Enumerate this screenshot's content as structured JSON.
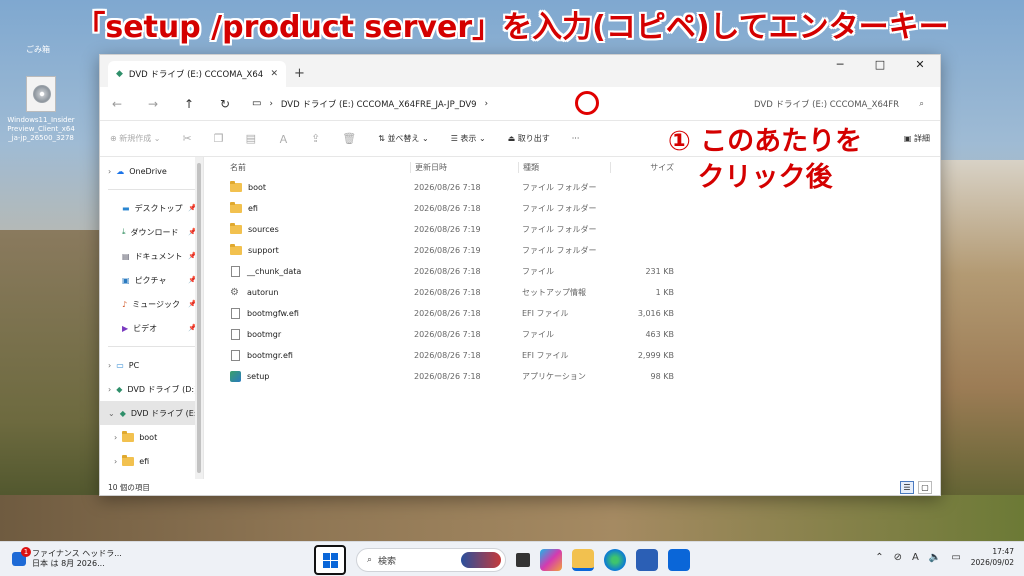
{
  "headline": "「setup /product server」を入力(コピペ)してエンターキー",
  "annotation": {
    "line1": "① このあたりを",
    "line2": "クリック後"
  },
  "desktop": {
    "top_label": "ごみ箱",
    "icon_label": "Windows11_Insider Preview_Client_x64 _ja-jp_26500_3278"
  },
  "window": {
    "tab_title": "DVD ドライブ (E:) CCCOMA_X64",
    "new_tab": "+",
    "minimize": "─",
    "maximize": "□",
    "close": "✕",
    "address": {
      "path_device": "DVD ドライブ (E:) CCCOMA_X64FRE_JA-JP_DV9",
      "search_placeholder": "DVD ドライブ (E:) CCCOMA_X64FR"
    },
    "toolbar": {
      "new": "新規作成",
      "sort": "並べ替え",
      "view": "表示",
      "eject": "取り出す",
      "details": "詳細"
    },
    "nav": {
      "onedrive": "OneDrive",
      "desktop": "デスクトップ",
      "downloads": "ダウンロード",
      "documents": "ドキュメント",
      "pictures": "ピクチャ",
      "music": "ミュージック",
      "videos": "ビデオ",
      "pc": "PC",
      "dvd_d": "DVD ドライブ (D:)",
      "dvd_e": "DVD ドライブ (E:)",
      "boot": "boot",
      "efi": "efi"
    },
    "columns": {
      "name": "名前",
      "date": "更新日時",
      "type": "種類",
      "size": "サイズ"
    },
    "files": [
      {
        "name": "boot",
        "date": "2026/08/26 7:18",
        "type": "ファイル フォルダー",
        "size": ""
      },
      {
        "name": "efi",
        "date": "2026/08/26 7:18",
        "type": "ファイル フォルダー",
        "size": ""
      },
      {
        "name": "sources",
        "date": "2026/08/26 7:19",
        "type": "ファイル フォルダー",
        "size": ""
      },
      {
        "name": "support",
        "date": "2026/08/26 7:19",
        "type": "ファイル フォルダー",
        "size": ""
      },
      {
        "name": "__chunk_data",
        "date": "2026/08/26 7:18",
        "type": "ファイル",
        "size": "231 KB"
      },
      {
        "name": "autorun",
        "date": "2026/08/26 7:18",
        "type": "セットアップ情報",
        "size": "1 KB"
      },
      {
        "name": "bootmgfw.efi",
        "date": "2026/08/26 7:18",
        "type": "EFI ファイル",
        "size": "3,016 KB"
      },
      {
        "name": "bootmgr",
        "date": "2026/08/26 7:18",
        "type": "ファイル",
        "size": "463 KB"
      },
      {
        "name": "bootmgr.efi",
        "date": "2026/08/26 7:18",
        "type": "EFI ファイル",
        "size": "2,999 KB"
      },
      {
        "name": "setup",
        "date": "2026/08/26 7:18",
        "type": "アプリケーション",
        "size": "98 KB"
      }
    ],
    "status": "10 個の項目"
  },
  "taskbar": {
    "news_title": "ファイナンス ヘッドラ...",
    "news_sub": "日本 は 8月 2026...",
    "search_label": "検索",
    "time": "17:47",
    "date": "2026/09/02",
    "ime": "A"
  },
  "colors": {
    "annotation_red": "#d40000",
    "accent_blue": "#0a66d8"
  }
}
